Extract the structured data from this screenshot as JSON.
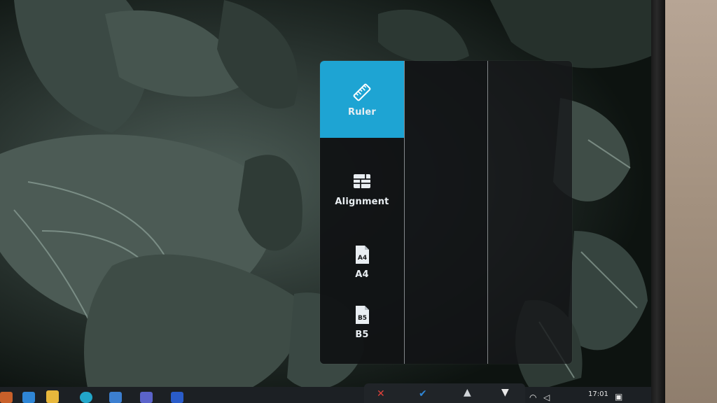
{
  "osd": {
    "menu": [
      {
        "id": "ruler",
        "label": "Ruler",
        "icon": "ruler-icon",
        "active": true
      },
      {
        "id": "alignment",
        "label": "Alignment",
        "icon": "grid-layout-icon",
        "active": false
      },
      {
        "id": "a4",
        "label": "A4",
        "icon": "document-a4-icon",
        "icon_text": "A4",
        "active": false
      },
      {
        "id": "b5",
        "label": "B5",
        "icon": "document-b5-icon",
        "icon_text": "B5",
        "active": false
      }
    ],
    "accent_color": "#1ea4d3"
  },
  "taskbar": {
    "clock": "17:01"
  }
}
